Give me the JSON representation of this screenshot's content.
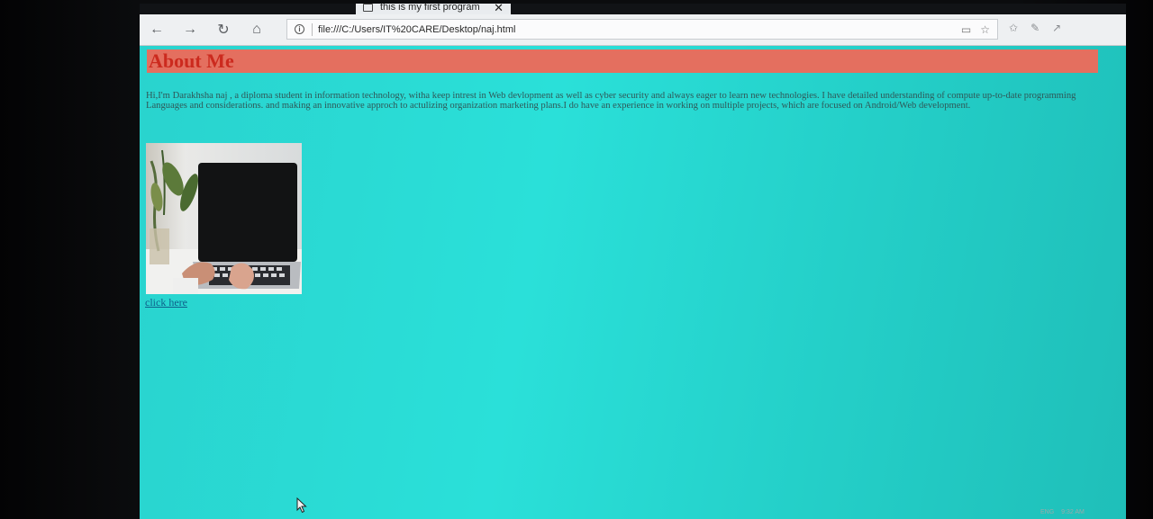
{
  "browser": {
    "tab_title": "this is my first program",
    "tab_close": "✕",
    "url": "file:///C:/Users/IT%20CARE/Desktop/naj.html",
    "nav": {
      "back_icon": "←",
      "forward_icon": "→",
      "refresh_icon": "↻",
      "home_icon": "⌂"
    }
  },
  "page": {
    "heading": "About Me",
    "paragraph": "Hi,I'm Darakhsha naj , a diploma student in information technology, witha keep intrest in Web devlopment as well as cyber security and always eager to learn new technologies. I have detailed understanding of compute up-to-date programming Languages and considerations. and making an innovative approch to actulizing organization marketing plans.I do have an experience in working on multiple projects, which are focused on Android/Web development.",
    "link_text": "click here"
  },
  "colors": {
    "page_background": "#2ad6d0",
    "heading_bar": "#e46f5f",
    "heading_text": "#cc2a1e",
    "link": "#0e5f8a"
  },
  "taskbar": {
    "lang": "ENG",
    "time": "9:32 AM"
  }
}
